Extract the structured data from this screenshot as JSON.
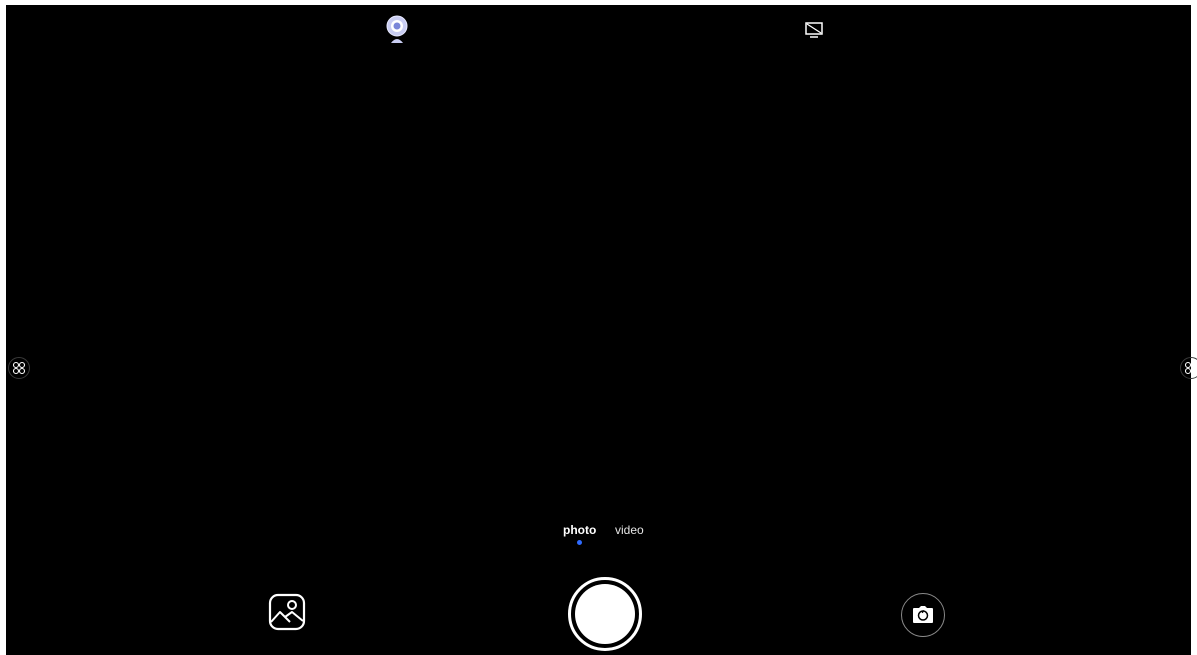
{
  "modes": {
    "photo_label": "photo",
    "video_label": "video",
    "selected": "photo"
  },
  "icons": {
    "top_left": "webcam-icon",
    "top_right": "cast-off-icon",
    "side_left": "grid-icon",
    "side_right": "grid-icon",
    "gallery": "gallery-icon",
    "shutter": "shutter-button",
    "switch_camera": "switch-camera-icon"
  },
  "colors": {
    "background": "#000000",
    "accent_dot": "#2f6bff",
    "webcam_tint": "#c9cdf2"
  }
}
